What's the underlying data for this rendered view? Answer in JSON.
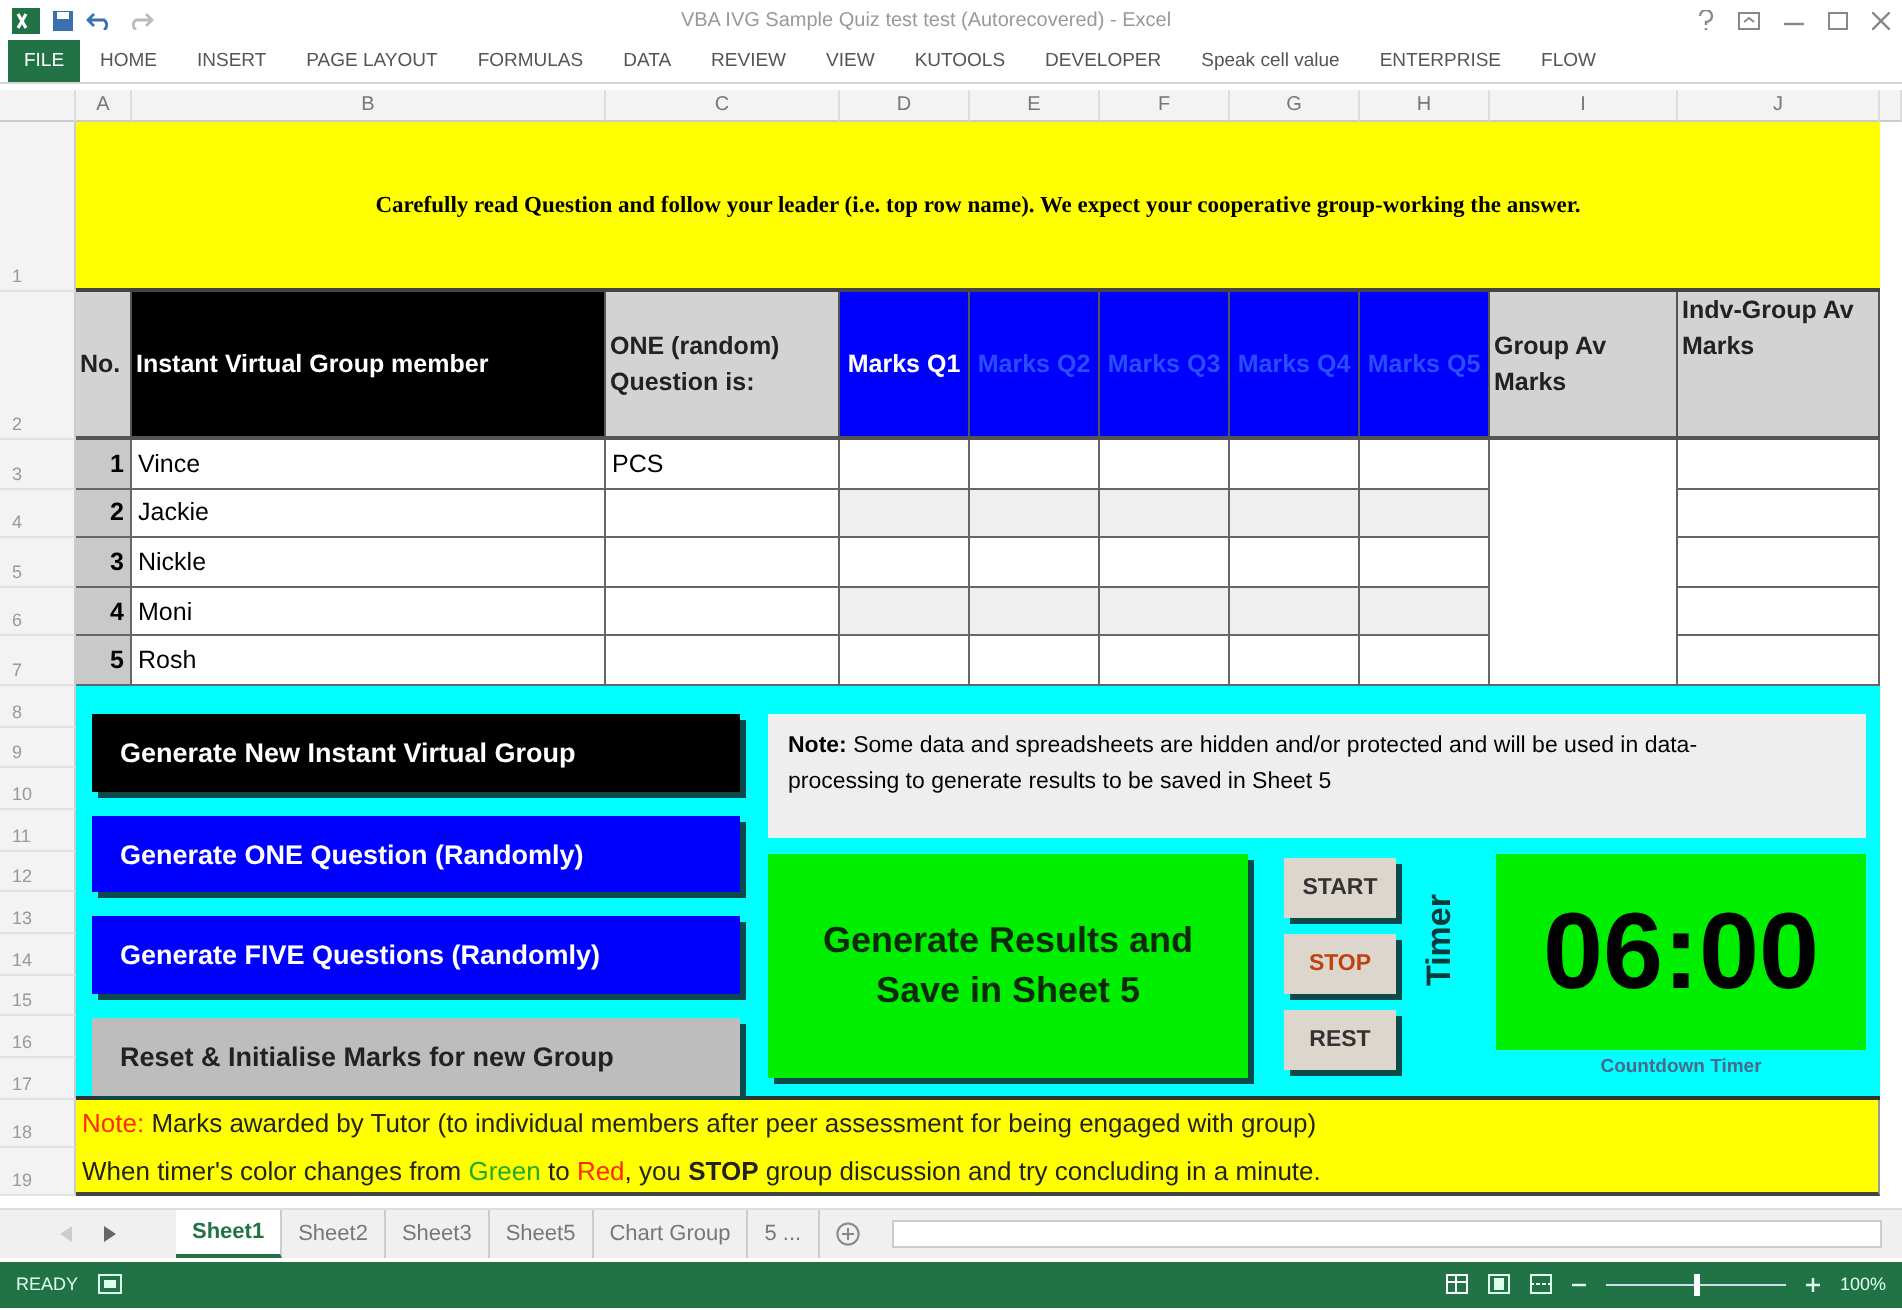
{
  "window": {
    "title": "VBA IVG Sample Quiz test test (Autorecovered) - Excel"
  },
  "ribbon": {
    "file_tab": "FILE",
    "tabs": [
      "HOME",
      "INSERT",
      "PAGE LAYOUT",
      "FORMULAS",
      "DATA",
      "REVIEW",
      "VIEW",
      "KUTOOLS",
      "DEVELOPER",
      "Speak cell value",
      "ENTERPRISE",
      "FLOW"
    ]
  },
  "sheet": {
    "columns": [
      "A",
      "B",
      "C",
      "D",
      "E",
      "F",
      "G",
      "H",
      "I",
      "J"
    ],
    "row_numbers": [
      "1",
      "2",
      "3",
      "4",
      "5",
      "6",
      "7",
      "8",
      "9",
      "10",
      "11",
      "12",
      "13",
      "14",
      "15",
      "16",
      "17",
      "18",
      "19"
    ],
    "banner": "Carefully read Question and follow your leader (i.e. top row name). We expect your cooperative group-working the answer.",
    "table": {
      "no_header": "No.",
      "member_header": "Instant Virtual Group member",
      "question_header": "ONE (random) Question is:",
      "marks_headers": [
        {
          "label": "Marks Q1",
          "dim": false
        },
        {
          "label": "Marks Q2",
          "dim": true
        },
        {
          "label": "Marks Q3",
          "dim": true
        },
        {
          "label": "Marks Q4",
          "dim": true
        },
        {
          "label": "Marks Q5",
          "dim": true
        }
      ],
      "group_av_header": "Group Av Marks",
      "indv_header": "Indv-Group Av Marks",
      "rows": [
        {
          "no": "1",
          "name": "Vince",
          "question": "PCS"
        },
        {
          "no": "2",
          "name": "Jackie"
        },
        {
          "no": "3",
          "name": "Nickle"
        },
        {
          "no": "4",
          "name": "Moni"
        },
        {
          "no": "5",
          "name": "Rosh"
        }
      ]
    },
    "buttons": [
      {
        "label": "Generate New Instant Virtual Group",
        "kind": "dark"
      },
      {
        "label": "Generate ONE Question (Randomly)",
        "kind": "blue"
      },
      {
        "label": "Generate FIVE Questions (Randomly)",
        "kind": "blue"
      },
      {
        "label": "Reset & Initialise Marks for new Group",
        "kind": "grey"
      }
    ],
    "note": "**Note:** Some data and spreadsheets are hidden and/or protected and will be used  in data-processing to generate results to be saved in Sheet 5",
    "results_button": "Generate Results and Save in Sheet 5",
    "timer_buttons": [
      {
        "label": "START",
        "kind": "plain"
      },
      {
        "label": "STOP",
        "kind": "alert"
      },
      {
        "label": "REST",
        "kind": "plain"
      }
    ],
    "timer_label": "Timer",
    "timer": "06:00",
    "timer_caption": "Countdown Timer",
    "footer_lines": [
      [
        {
          "text": "Note:",
          "kind": "red"
        },
        {
          "text": " Marks awarded by Tutor (to individual members after peer assessment for being engaged with group)",
          "kind": "plain"
        }
      ],
      [
        {
          "text": "When timer's color changes from ",
          "kind": "plain"
        },
        {
          "text": "Green",
          "kind": "green"
        },
        {
          "text": " to ",
          "kind": "plain"
        },
        {
          "text": "Red",
          "kind": "red"
        },
        {
          "text": ", you ",
          "kind": "plain"
        },
        {
          "text": "STOP",
          "kind": "bold"
        },
        {
          "text": " group discussion and try concluding in a minute.",
          "kind": "plain"
        }
      ]
    ]
  },
  "sheet_tabs": [
    {
      "label": "Sheet1",
      "selected": true
    },
    {
      "label": "Sheet2",
      "selected": false
    },
    {
      "label": "Sheet3",
      "selected": false
    },
    {
      "label": "Sheet5",
      "selected": false
    },
    {
      "label": "Chart Group",
      "selected": false
    },
    {
      "label": "5 ...",
      "selected": false
    }
  ],
  "status_bar": {
    "mode": "READY",
    "zoom": {
      "level": 0.5,
      "reading": "100%"
    }
  }
}
